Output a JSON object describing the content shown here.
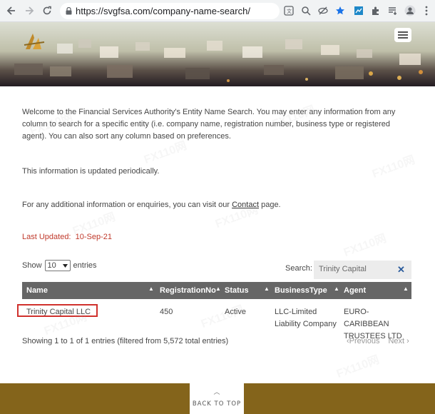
{
  "browser": {
    "url": "https://svgfsa.com/company-name-search/"
  },
  "intro": {
    "paragraph": "Welcome to the Financial Services Authority's Entity Name Search. You may enter any information from any column to search for a specific entity (i.e. company name, registration number, business type or registered agent). You can also sort any column based on preferences.",
    "periodic": "This information is updated periodically.",
    "enquiries_before": "For any additional information or enquiries, you can visit our ",
    "contact_link": "Contact",
    "enquiries_after": " page."
  },
  "last_updated": {
    "label": "Last Updated:",
    "date": "10-Sep-21"
  },
  "table_controls": {
    "show_label": "Show",
    "show_value": "10",
    "entries_label": "entries",
    "search_label": "Search:",
    "search_value": "Trinity Capital"
  },
  "table": {
    "headers": [
      "Name",
      "RegistrationNo",
      "Status",
      "BusinessType",
      "Agent"
    ],
    "rows": [
      {
        "name": "Trinity Capital LLC",
        "registration_no": "450",
        "status": "Active",
        "business_type_line1": "LLC-Limited",
        "business_type_line2": "Liability Company",
        "agent_line1": "EURO-CARIBBEAN",
        "agent_line2": "TRUSTEES LTD"
      }
    ]
  },
  "pagination": {
    "info": "Showing 1 to 1 of 1 entries (filtered from 5,572 total entries)",
    "previous": "Previous",
    "next": "Next"
  },
  "footer": {
    "back_to_top": "BACK TO TOP"
  },
  "watermark": "FX110网",
  "colors": {
    "footer": "#84641b",
    "table_header": "#666666",
    "last_updated": "#c0392b",
    "highlight_box": "#d0312d"
  }
}
